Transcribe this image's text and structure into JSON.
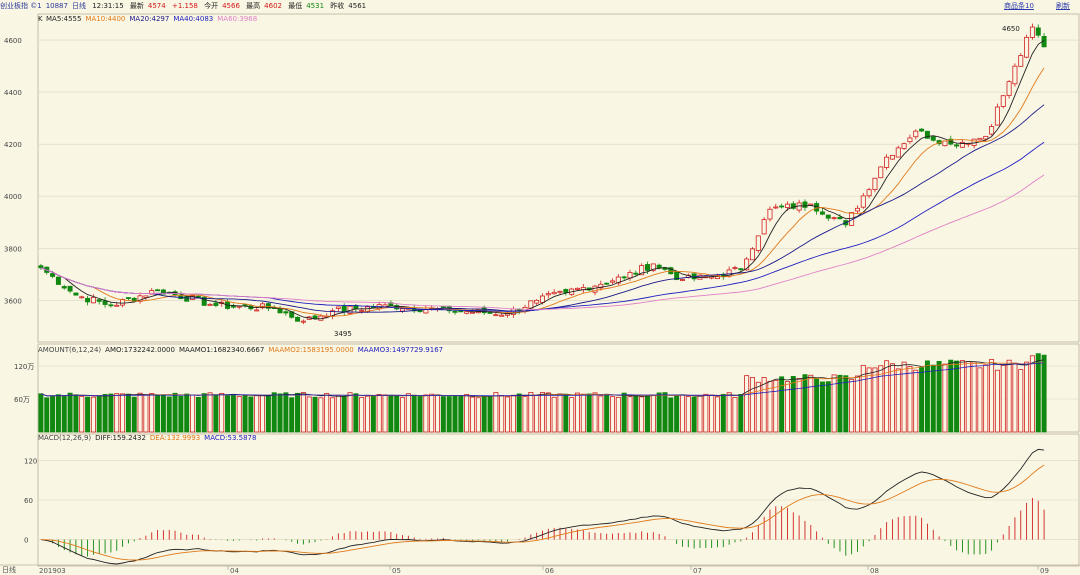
{
  "header": {
    "stock": "创业板指 ©1",
    "code": "10887",
    "period": "日线",
    "time": "12:31:15",
    "latest_label": "最新",
    "latest": "4574",
    "change": "+1.158",
    "open_label": "今开",
    "open": "4566",
    "high_label": "最高",
    "high": "4602",
    "low_label": "最低",
    "low": "4531",
    "prev_label": "昨收",
    "prev": "4561",
    "link_product": "商品条10",
    "link_refresh": "刷新"
  },
  "price_panel": {
    "tag": "K",
    "legend": [
      {
        "text": "MA5:4555",
        "color": "#222222"
      },
      {
        "text": "MA10:4400",
        "color": "#e07a1a"
      },
      {
        "text": "MA20:4297",
        "color": "#1a1a8a"
      },
      {
        "text": "MA40:4083",
        "color": "#2020c0"
      },
      {
        "text": "MA60:3968",
        "color": "#e080c8"
      }
    ],
    "high_marker": "4650",
    "low_marker": "3495"
  },
  "volume_panel": {
    "legend": [
      {
        "text": "AMOUNT(6,12,24)",
        "color": "#444444"
      },
      {
        "text": "AMO:1732242.0000",
        "color": "#222222"
      },
      {
        "text": "MAAMO1:1682340.6667",
        "color": "#222222"
      },
      {
        "text": "MAAMO2:1583195.0000",
        "color": "#e07a1a"
      },
      {
        "text": "MAAMO3:1497729.9167",
        "color": "#2020c0"
      }
    ]
  },
  "macd_panel": {
    "legend": [
      {
        "text": "MACD(12,26,9)",
        "color": "#444444"
      },
      {
        "text": "DIFF:159.2432",
        "color": "#222222"
      },
      {
        "text": "DEA:132.9993",
        "color": "#e07a1a"
      },
      {
        "text": "MACD:53.5878",
        "color": "#2020c0"
      }
    ]
  },
  "footer": {
    "period_label": "日线"
  },
  "colors": {
    "up": "#d02020",
    "down": "#118811",
    "grid": "#dcd6bc",
    "bg": "#faf6e4"
  },
  "chart_data": {
    "type": "candlestick",
    "x_axis_labels": [
      "201903",
      "04",
      "05",
      "06",
      "07",
      "08",
      "09"
    ],
    "price": {
      "ylim": [
        3440,
        4700
      ],
      "ticks": [
        3600,
        3800,
        4000,
        4200,
        4400,
        4600
      ],
      "ohlc_keypoints": [
        {
          "i": 0,
          "close": 3725
        },
        {
          "i": 6,
          "close": 3620
        },
        {
          "i": 12,
          "close": 3580
        },
        {
          "i": 20,
          "close": 3640
        },
        {
          "i": 30,
          "close": 3580
        },
        {
          "i": 40,
          "close": 3570
        },
        {
          "i": 45,
          "close": 3520
        },
        {
          "i": 50,
          "close": 3560
        },
        {
          "i": 60,
          "close": 3580
        },
        {
          "i": 70,
          "close": 3560
        },
        {
          "i": 80,
          "close": 3550
        },
        {
          "i": 85,
          "close": 3600
        },
        {
          "i": 90,
          "close": 3630
        },
        {
          "i": 100,
          "close": 3690
        },
        {
          "i": 105,
          "close": 3740
        },
        {
          "i": 110,
          "close": 3680
        },
        {
          "i": 115,
          "close": 3690
        },
        {
          "i": 120,
          "close": 3720
        },
        {
          "i": 125,
          "close": 3950
        },
        {
          "i": 132,
          "close": 3970
        },
        {
          "i": 138,
          "close": 3890
        },
        {
          "i": 145,
          "close": 4150
        },
        {
          "i": 150,
          "close": 4250
        },
        {
          "i": 156,
          "close": 4200
        },
        {
          "i": 162,
          "close": 4230
        },
        {
          "i": 166,
          "close": 4440
        },
        {
          "i": 170,
          "close": 4650
        },
        {
          "i": 172,
          "close": 4574
        }
      ]
    },
    "volume": {
      "ticks": [
        {
          "value": 60,
          "label": "60万"
        },
        {
          "value": 120,
          "label": "120万"
        }
      ],
      "ylim": [
        0,
        160
      ]
    },
    "macd": {
      "ticks": [
        0,
        60,
        120
      ],
      "ylim": [
        -40,
        160
      ],
      "final": {
        "diff": 159.2432,
        "dea": 132.9993,
        "macd": 53.5878
      }
    }
  }
}
